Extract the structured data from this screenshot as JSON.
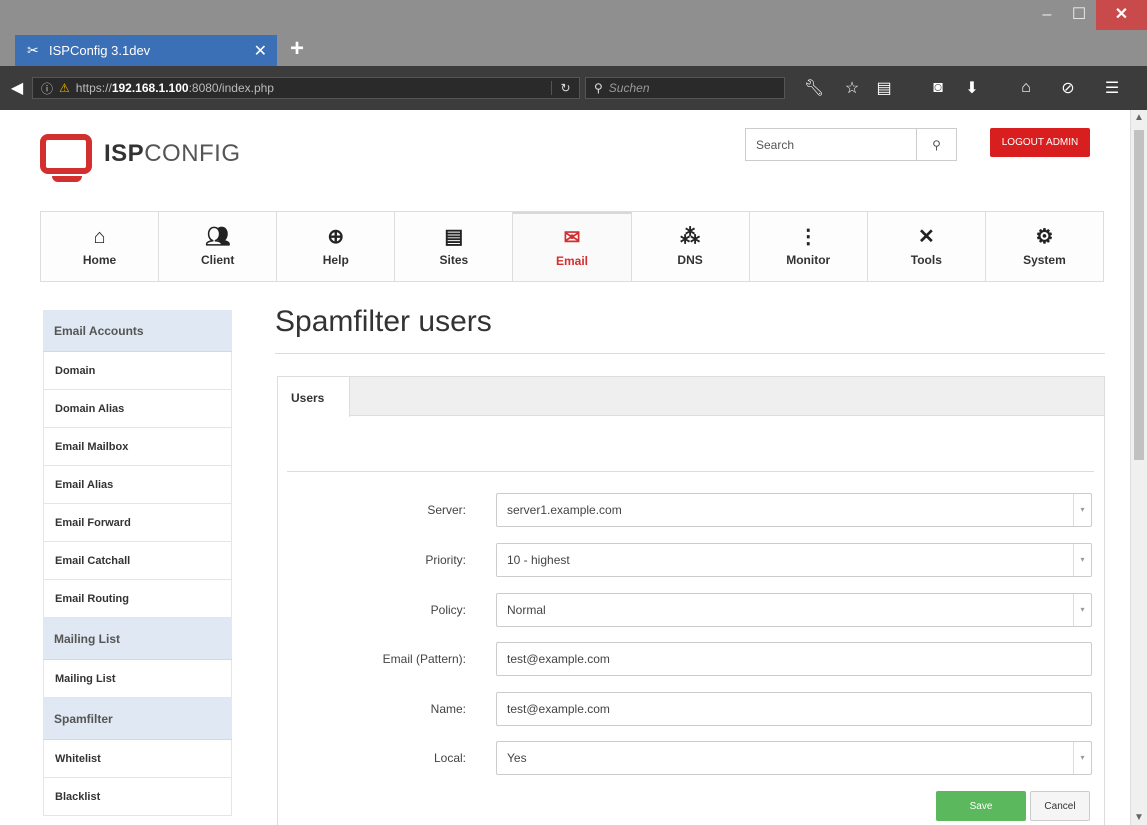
{
  "browser": {
    "tab_title": "ISPConfig 3.1dev",
    "tab_close": "✕",
    "new_tab": "+",
    "url_prefix": "https://",
    "url_host": "192.168.1.100",
    "url_rest": ":8080/index.php",
    "search_placeholder": "Suchen",
    "window_buttons": {
      "minimize": "‒",
      "maximize": "☐",
      "close": "✕"
    }
  },
  "header": {
    "logo_bold": "ISP",
    "logo_rest": "CONFIG",
    "search_placeholder": "Search",
    "logout_label": "LOGOUT ADMIN"
  },
  "main_nav": [
    {
      "label": "Home",
      "icon": "home-icon"
    },
    {
      "label": "Client",
      "icon": "users-icon"
    },
    {
      "label": "Help",
      "icon": "lifebuoy-icon"
    },
    {
      "label": "Sites",
      "icon": "window-icon"
    },
    {
      "label": "Email",
      "icon": "envelope-icon",
      "active": true
    },
    {
      "label": "DNS",
      "icon": "network-icon"
    },
    {
      "label": "Monitor",
      "icon": "traffic-light-icon"
    },
    {
      "label": "Tools",
      "icon": "tools-icon"
    },
    {
      "label": "System",
      "icon": "gear-icon"
    }
  ],
  "sidebar": {
    "sections": [
      {
        "title": "Email Accounts",
        "items": [
          "Domain",
          "Domain Alias",
          "Email Mailbox",
          "Email Alias",
          "Email Forward",
          "Email Catchall",
          "Email Routing"
        ]
      },
      {
        "title": "Mailing List",
        "items": [
          "Mailing List"
        ]
      },
      {
        "title": "Spamfilter",
        "items": [
          "Whitelist",
          "Blacklist"
        ]
      }
    ]
  },
  "content": {
    "title": "Spamfilter users",
    "tab_label": "Users",
    "fields": [
      {
        "label": "Server:",
        "value": "server1.example.com",
        "type": "select"
      },
      {
        "label": "Priority:",
        "value": "10 - highest",
        "type": "select"
      },
      {
        "label": "Policy:",
        "value": "Normal",
        "type": "select"
      },
      {
        "label": "Email (Pattern):",
        "value": "test@example.com",
        "type": "text"
      },
      {
        "label": "Name:",
        "value": "test@example.com",
        "type": "text"
      },
      {
        "label": "Local:",
        "value": "Yes",
        "type": "select"
      }
    ],
    "save_label": "Save",
    "cancel_label": "Cancel"
  }
}
